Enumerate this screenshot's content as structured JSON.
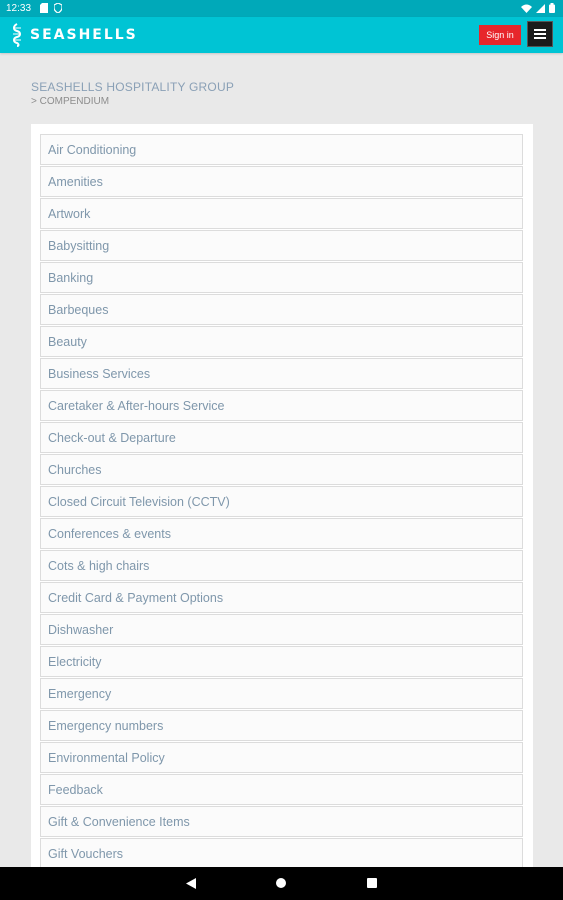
{
  "status_bar": {
    "time": "12:33",
    "icons": [
      "sd-card-icon",
      "shield-icon",
      "wifi-icon",
      "signal-icon",
      "battery-icon"
    ]
  },
  "header": {
    "brand": "SEASHELLS",
    "logo_icon": "seashell-icon",
    "signin_label": "Sign in",
    "menu_icon": "hamburger-menu-icon",
    "colors": {
      "header": "#00c4d4",
      "status": "#00a9b9",
      "signin": "#e7262b"
    }
  },
  "breadcrumb": {
    "title": "SEASHELLS HOSPITALITY GROUP",
    "sub": "> COMPENDIUM"
  },
  "list": {
    "items": [
      "Air Conditioning",
      "Amenities",
      "Artwork",
      "Babysitting",
      "Banking",
      "Barbeques",
      "Beauty",
      "Business Services",
      "Caretaker & After-hours Service",
      "Check-out & Departure",
      "Churches",
      "Closed Circuit Television (CCTV)",
      "Conferences & events",
      "Cots & high chairs",
      "Credit Card & Payment Options",
      "Dishwasher",
      "Electricity",
      "Emergency",
      "Emergency numbers",
      "Environmental Policy",
      "Feedback",
      "Gift & Convenience Items",
      "Gift Vouchers"
    ]
  },
  "nav_bar": {
    "icons": [
      "back-icon",
      "home-icon",
      "recent-apps-icon"
    ]
  }
}
